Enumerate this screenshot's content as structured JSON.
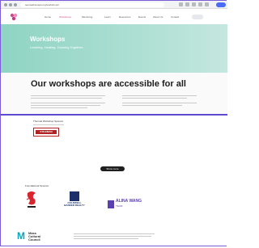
{
  "browser": {
    "url": "teenwellnesspa.org/workshops/"
  },
  "nav": {
    "items": [
      "Home",
      "Workshops",
      "Mentoring",
      "Learn",
      "Resources",
      "Events",
      "About Us",
      "Contact",
      "Donate"
    ]
  },
  "hero": {
    "title": "Workshops",
    "subtitle": "Learning. Healing. Growing Together."
  },
  "access": {
    "heading": "Our workshops are accessible for all"
  },
  "sponsors": {
    "featured_title": "Thermal Workshop Sponsor",
    "featured_logo": "STILEMAN",
    "more_button": "Show more",
    "foundational_title": "Foundational Sponsor",
    "coldwell_text": "COLDWELL BANKER REALTY",
    "alina_name": "ALINA WANG",
    "alina_sub": "TEAM",
    "mcc_text": "Mass Cultural Council"
  },
  "colors": {
    "hero": "#8fd4c4",
    "accent": "#5c4bd1",
    "brand_pink": "#d14a8e"
  }
}
